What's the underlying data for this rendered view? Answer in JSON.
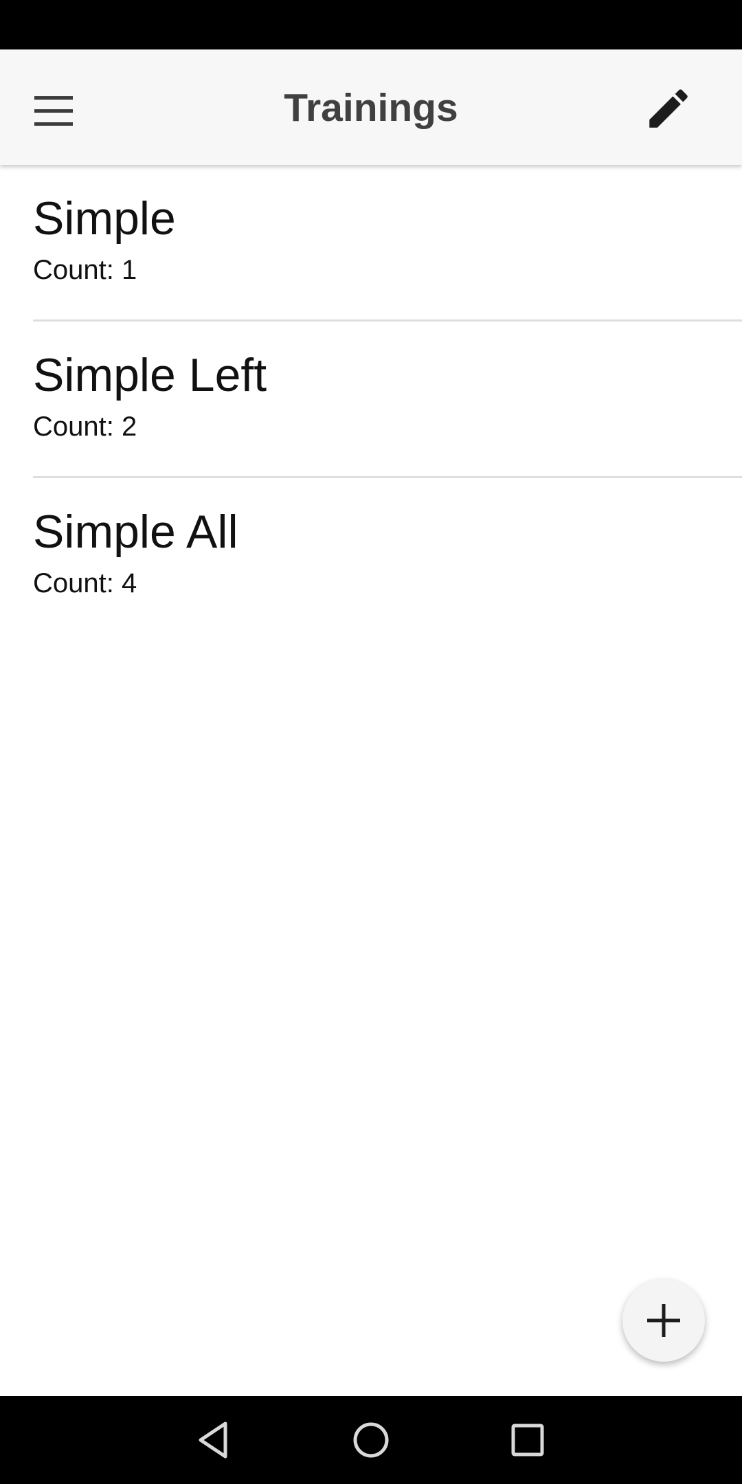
{
  "app_bar": {
    "title": "Trainings",
    "menu_icon": "hamburger-menu-icon",
    "edit_icon": "pencil-icon"
  },
  "trainings": [
    {
      "name": "Simple",
      "count": "Count: 1"
    },
    {
      "name": "Simple Left",
      "count": "Count: 2"
    },
    {
      "name": "Simple All",
      "count": "Count: 4"
    }
  ],
  "fab": {
    "icon": "plus-icon"
  },
  "navigation": {
    "back_icon": "back-triangle-icon",
    "home_icon": "home-circle-icon",
    "recents_icon": "recents-square-icon"
  },
  "colors": {
    "app_bar_background": "#f7f7f7",
    "title_text": "#404040",
    "system_bars": "#000000",
    "divider": "#dedede"
  }
}
